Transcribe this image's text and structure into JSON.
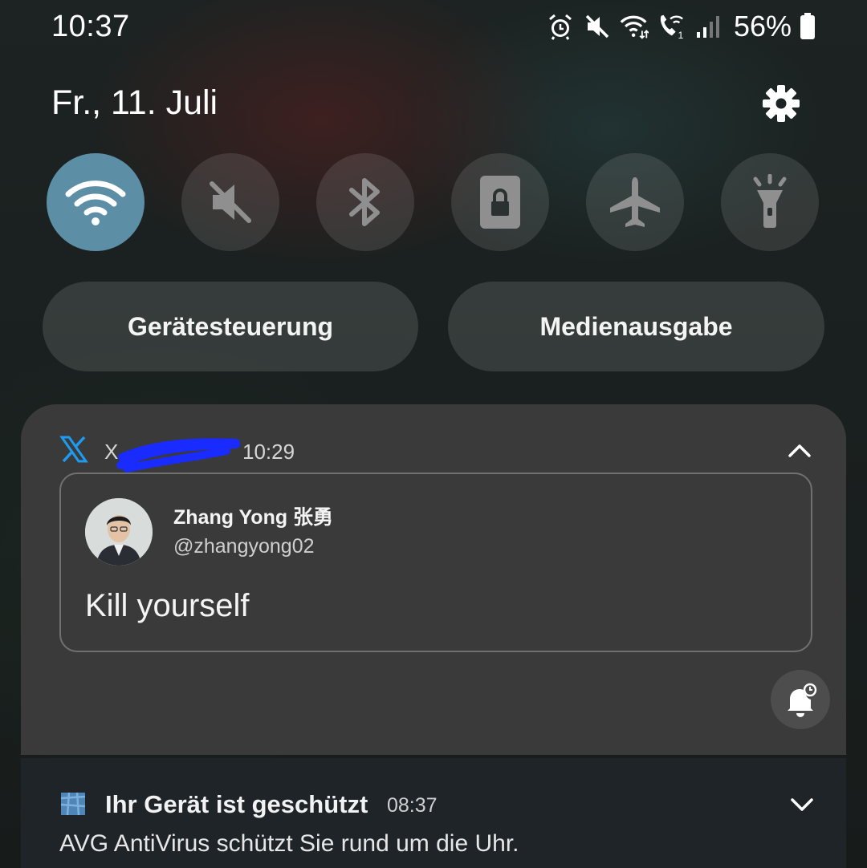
{
  "status_bar": {
    "time": "10:37",
    "battery_percent": "56%",
    "icons": [
      "alarm-icon",
      "mute-icon",
      "wifi-data-icon",
      "wifi-call-icon",
      "signal-icon",
      "battery-icon"
    ]
  },
  "header": {
    "date": "Fr., 11. Juli",
    "settings_icon": "gear-icon"
  },
  "quick_settings": [
    {
      "name": "wifi",
      "icon": "wifi-icon",
      "active": true
    },
    {
      "name": "sound",
      "icon": "mute-icon",
      "active": false
    },
    {
      "name": "bluetooth",
      "icon": "bluetooth-icon",
      "active": false
    },
    {
      "name": "rotation-lock",
      "icon": "screen-lock-icon",
      "active": false
    },
    {
      "name": "airplane",
      "icon": "airplane-icon",
      "active": false
    },
    {
      "name": "flashlight",
      "icon": "flashlight-icon",
      "active": false
    }
  ],
  "pills": {
    "device_control": "Gerätesteuerung",
    "media_output": "Medienausgabe"
  },
  "x_notification": {
    "app": "X",
    "time": "10:29",
    "author_name": "Zhang Yong 张勇",
    "author_handle": "@zhangyong02",
    "text": "Kill yourself",
    "accent_color": "#1d9bf0"
  },
  "avg_notification": {
    "title": "Ihr Gerät ist geschützt",
    "time": "08:37",
    "body": "AVG AntiVirus schützt Sie rund um die Uhr."
  },
  "colors": {
    "wifi_active": "#5c8ea6",
    "notification_bg": "#3a3a3a",
    "avg_bg": "#1f2429"
  }
}
